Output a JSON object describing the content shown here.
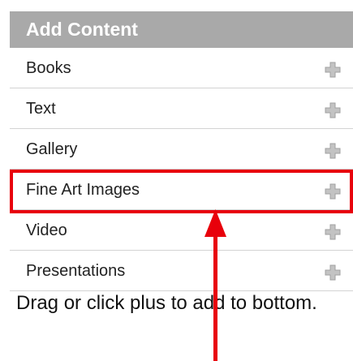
{
  "panel": {
    "title": "Add Content",
    "items": [
      {
        "label": "Books",
        "icon": "plus-icon"
      },
      {
        "label": "Text",
        "icon": "plus-icon"
      },
      {
        "label": "Gallery",
        "icon": "plus-icon"
      },
      {
        "label": "Fine Art Images",
        "icon": "plus-icon"
      },
      {
        "label": "Video",
        "icon": "plus-icon"
      },
      {
        "label": "Presentations",
        "icon": "plus-icon"
      }
    ],
    "hint": "Drag or click plus to add to bottom."
  },
  "colors": {
    "header_bg": "#a9a9a9",
    "highlight": "#e8000b",
    "icon_gray": "#b9b9b9"
  }
}
